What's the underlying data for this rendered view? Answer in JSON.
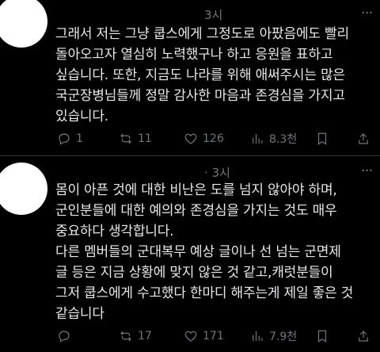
{
  "posts": [
    {
      "meta_time": "3시",
      "more": "···",
      "text": "그래서 저는 그냥 쿱스에게 그정도로 아팠음에도 빨리\n돌아오고자 열심히 노력했구나 하고 응원을 표하고\n싶습니다. 또한, 지금도 나라를 위해 애써주시는 많은\n국군장병님들께 정말 감사한 마음과 존경심을 가지고\n있습니다.",
      "replies": "1",
      "reposts": "11",
      "likes": "126",
      "views": "8.3천"
    },
    {
      "meta_time": "· 3시",
      "more": "···",
      "text": "몸이 아픈 것에 대한 비난은 도를 넘지 않아야 하며,\n군인분들에 대한 예의와 존경심을 가지는 것도 매우\n중요하다 생각합니다.\n다른 멤버들의 군대복무 예상 글이나 선 넘는 군면제\n글 등은 지금 상황에 맞지 않은 것 같고,캐럿분들이\n그저 쿱스에게 수고했다 한마디 해주는게 제일 좋은 것\n같습니다",
      "replies": "",
      "reposts": "17",
      "likes": "171",
      "views": "7.9천"
    }
  ],
  "colors": {
    "background": "#000000",
    "text": "#e7e9ea",
    "muted": "#71767b",
    "divider": "#2f3336"
  }
}
